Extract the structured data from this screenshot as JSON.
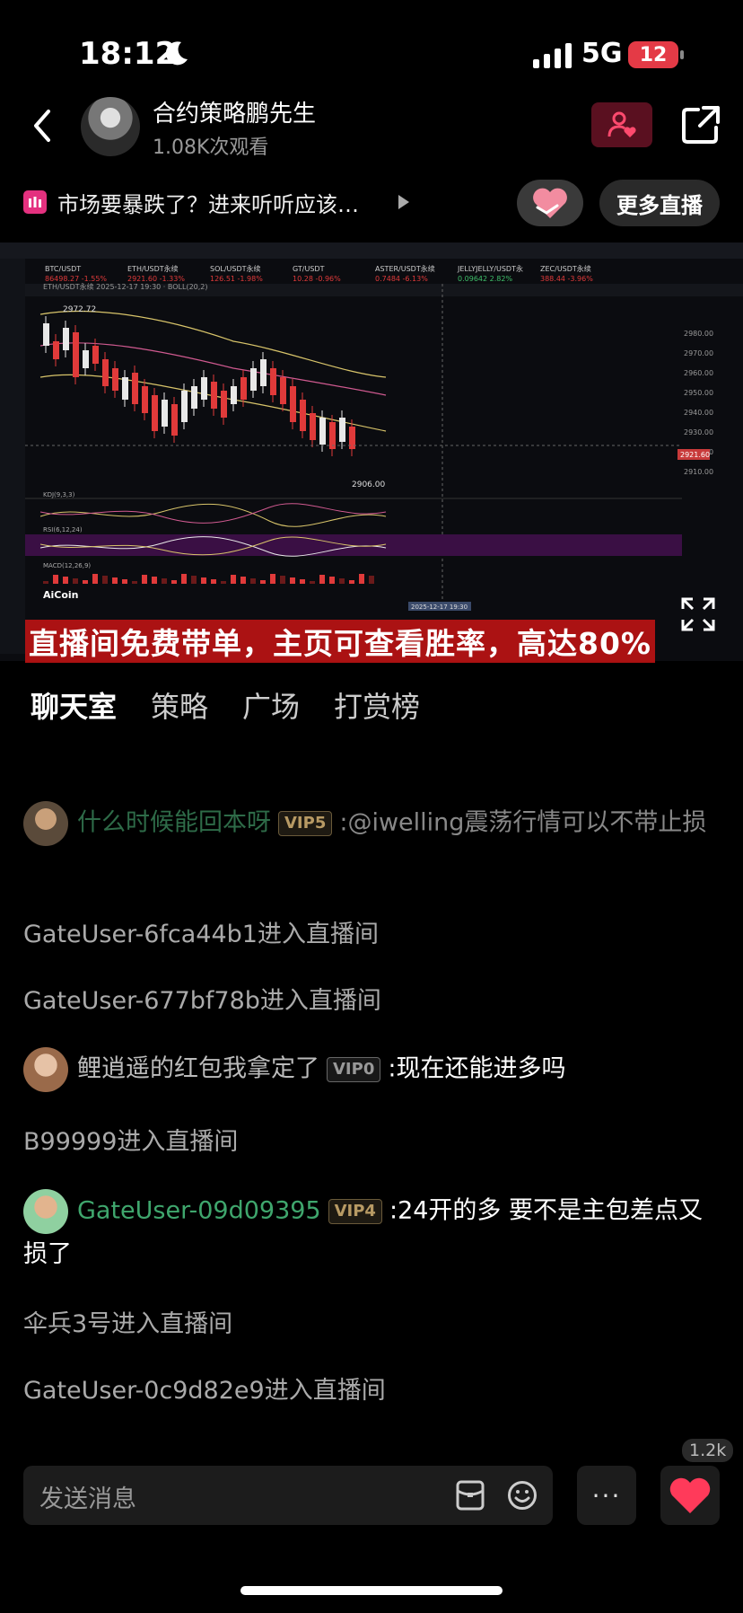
{
  "status_bar": {
    "time": "18:12",
    "network": "5G",
    "battery": "12"
  },
  "header": {
    "host_name": "合约策略鹏先生",
    "viewers": "1.08K次观看"
  },
  "topic": {
    "text": "市场要暴跌了？进来听听应该…",
    "more_live": "更多直播"
  },
  "video": {
    "caption": "直播间免费带单，主页可查看胜率，高达80%",
    "chart_tickers": [
      {
        "name": "BTC/USDT",
        "price": "86498.27",
        "change": "-1.55%"
      },
      {
        "name": "ETH/USDT永续",
        "price": "2921.60",
        "change": "-1.33%"
      },
      {
        "name": "SOL/USDT永续",
        "price": "126.51",
        "change": "-1.98%"
      },
      {
        "name": "GT/USDT",
        "price": "10.28",
        "change": "-0.96%"
      },
      {
        "name": "ASTER/USDT永续",
        "price": "0.7484",
        "change": "-6.13%"
      },
      {
        "name": "JELLYJELLY/USDT永",
        "price": "0.09642",
        "change": "2.82%"
      },
      {
        "name": "ZEC/USDT永续",
        "price": "388.44",
        "change": "-3.96%"
      }
    ],
    "chart_labels": {
      "high": "2972.72",
      "low": "2906.00",
      "current": "2921.60",
      "brand": "AiCoin",
      "date": "2025-12-17 19:30",
      "kdj": "KDJ(9,3,3)",
      "rsi": "RSI(6,12,24)",
      "macd": "MACD(12,26,9)",
      "axis": [
        "2980.00",
        "2970.00",
        "2960.00",
        "2950.00",
        "2940.00",
        "2930.00",
        "2920.00",
        "2910.00"
      ]
    },
    "colors": {
      "up": "#e8e8e8",
      "down": "#e03a3a",
      "caption_bg": "#c81414"
    }
  },
  "tabs": [
    "聊天室",
    "策略",
    "广场",
    "打赏榜"
  ],
  "chat": [
    {
      "type": "msg",
      "user": "什么时候能回本呀",
      "vip": "VIP5",
      "text": ":@iwelling震荡行情可以不带止损",
      "dim": true
    },
    {
      "type": "sys",
      "text": "GateUser-6fca44b1进入直播间"
    },
    {
      "type": "sys",
      "text": "GateUser-677bf78b进入直播间"
    },
    {
      "type": "msg",
      "user": "鲤逍遥的红包我拿定了",
      "vip": "VIP0",
      "text": ":现在还能进多吗",
      "plain_user": true
    },
    {
      "type": "sys",
      "text": "B99999进入直播间"
    },
    {
      "type": "msg",
      "user": "GateUser-09d09395",
      "vip": "VIP4",
      "text": ":24开的多   要不是主包差点又损了"
    },
    {
      "type": "sys",
      "text": "伞兵3号进入直播间"
    },
    {
      "type": "sys",
      "text": "GateUser-0c9d82e9进入直播间"
    }
  ],
  "bottom": {
    "placeholder": "发送消息",
    "likes": "1.2k",
    "more": "···"
  }
}
